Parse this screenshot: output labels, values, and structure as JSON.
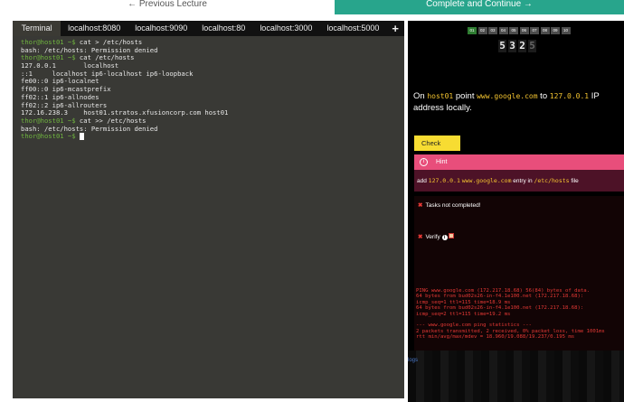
{
  "nav": {
    "prev_label": "← Previous Lecture",
    "next_label": "Complete and Continue →"
  },
  "tabs": [
    {
      "label": "Terminal"
    },
    {
      "label": "localhost:8080"
    },
    {
      "label": "localhost:9090"
    },
    {
      "label": "localhost:80"
    },
    {
      "label": "localhost:3000"
    },
    {
      "label": "localhost:5000"
    },
    {
      "label": "+"
    }
  ],
  "terminal": {
    "prompt": "thor@host01 ~$",
    "lines": [
      {
        "type": "cmd",
        "text": " cat > /etc/hosts"
      },
      {
        "type": "out",
        "text": "bash: /etc/hosts: Permission denied"
      },
      {
        "type": "cmd",
        "text": " cat /etc/hosts"
      },
      {
        "type": "out",
        "text": "127.0.0.1       localhost"
      },
      {
        "type": "out",
        "text": "::1     localhost ip6-localhost ip6-loopback"
      },
      {
        "type": "out",
        "text": "fe00::0 ip6-localnet"
      },
      {
        "type": "out",
        "text": "ff00::0 ip6-mcastprefix"
      },
      {
        "type": "out",
        "text": "ff02::1 ip6-allnodes"
      },
      {
        "type": "out",
        "text": "ff02::2 ip6-allrouters"
      },
      {
        "type": "out",
        "text": "172.16.238.3    host01.stratos.xfusioncorp.com host01"
      },
      {
        "type": "cmd",
        "text": " cat >> /etc/hosts"
      },
      {
        "type": "out",
        "text": "bash: /etc/hosts: Permission denied"
      },
      {
        "type": "cmd",
        "text": " "
      }
    ]
  },
  "progress": {
    "steps": [
      "01",
      "02",
      "03",
      "04",
      "05",
      "06",
      "07",
      "08",
      "09",
      "10"
    ],
    "completed": 1
  },
  "timer": {
    "digits": [
      "5",
      "3",
      "2",
      "5"
    ]
  },
  "task": {
    "pre": "On ",
    "host": "host01",
    "mid": " point ",
    "domain": "www.google.com",
    "to": " to ",
    "ip": "127.0.0.1",
    "post": " IP address locally."
  },
  "check_label": "Check",
  "hint": {
    "title": "Hint",
    "icon": "info-icon",
    "pre": "add ",
    "ip": "127.0.0.1",
    "domain": "www.google.com",
    "mid": " entry in ",
    "file": "/etc/hosts",
    "post": " file"
  },
  "status": {
    "tasks_text": "Tasks not completed!",
    "verify_label": "Verify"
  },
  "output_lines": [
    "PING www.google.com (172.217.18.68) 56(84) bytes of data.",
    "64 bytes from bud02s26-in-f4.1e100.net (172.217.18.68):",
    "icmp_seq=1 ttl=115 time=18.9 ms",
    "64 bytes from bud02s26-in-f4.1e100.net (172.217.18.68):",
    "icmp_seq=2 ttl=115 time=19.2 ms",
    "",
    "--- www.google.com ping statistics ---",
    "2 packets transmitted, 2 received, 0% packet loss, time 1001ms",
    "rtt min/avg/max/mdev = 18.960/19.088/19.237/0.195 ms"
  ],
  "logs_label": "logs",
  "colors": {
    "accent": "#28a58c",
    "prompt": "#6fb43f",
    "highlight": "#f4c430",
    "hint": "#e84e7b",
    "error": "#e53935"
  }
}
